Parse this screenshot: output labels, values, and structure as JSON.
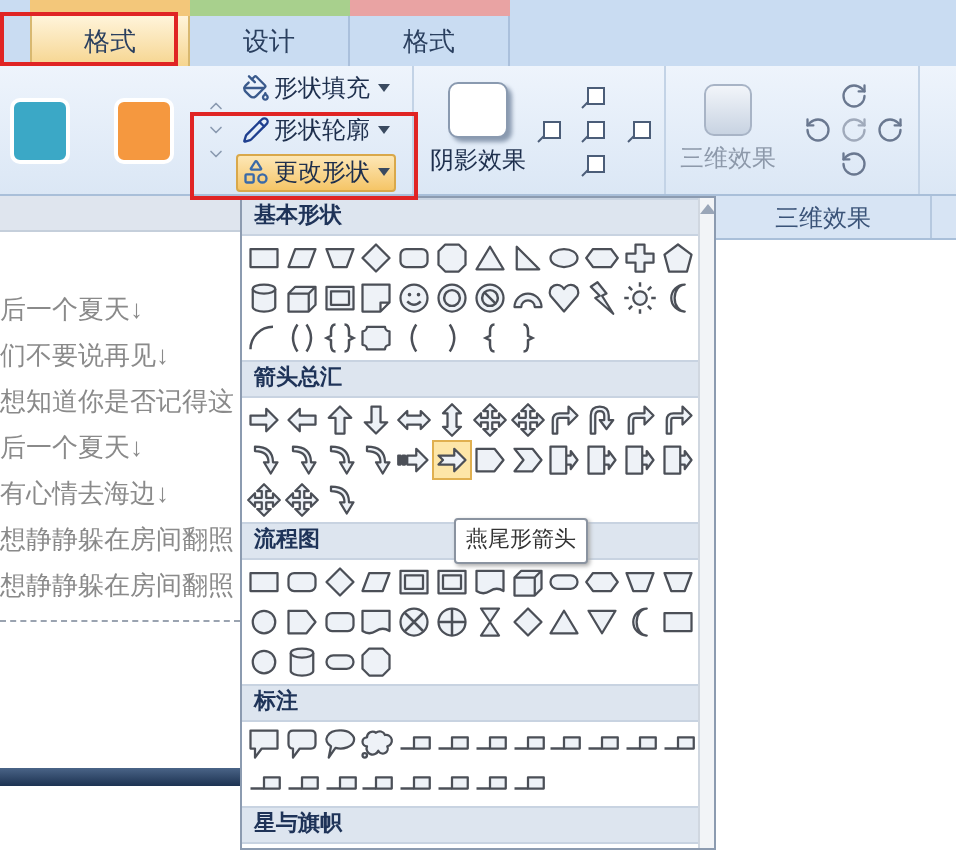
{
  "tabs": [
    {
      "label": "格式",
      "selected": true,
      "color": "#f3c77a"
    },
    {
      "label": "设计",
      "selected": false,
      "color": "#a8d08d"
    },
    {
      "label": "格式",
      "selected": false,
      "color": "#e9a3a3"
    }
  ],
  "ribbon": {
    "style_swatches": [
      {
        "color": "#3ba8c6"
      },
      {
        "color": "#f5983f"
      }
    ],
    "commands": [
      {
        "kind": "fill",
        "label": "形状填充",
        "selected": false
      },
      {
        "kind": "outline",
        "label": "形状轮廓",
        "selected": false
      },
      {
        "kind": "change",
        "label": "更改形状",
        "selected": true
      }
    ],
    "shadow_button": {
      "label": "阴影效果"
    },
    "three_d_button": {
      "label": "三维效果",
      "disabled": true
    },
    "group_label": "三维效果"
  },
  "document": {
    "lines": [
      "后一个夏天↓",
      "们不要说再见↓",
      "想知道你是否记得这",
      "后一个夏天↓",
      "有心情去海边↓",
      "想静静躲在房间翻照",
      "想静静躲在房间翻照"
    ]
  },
  "shape_menu": {
    "tooltip": "燕尾形箭头",
    "sections": [
      {
        "title": "基本形状",
        "rows": [
          [
            {
              "kind": "rect",
              "selected": false
            },
            {
              "kind": "parallelogram",
              "selected": false
            },
            {
              "kind": "trapezoid",
              "selected": false
            },
            {
              "kind": "diamond",
              "selected": false
            },
            {
              "kind": "roundrect",
              "selected": false
            },
            {
              "kind": "octagon",
              "selected": false
            },
            {
              "kind": "triangle",
              "selected": false
            },
            {
              "kind": "rtriangle",
              "selected": false
            },
            {
              "kind": "ellipse",
              "selected": false
            },
            {
              "kind": "hexagon",
              "selected": false
            },
            {
              "kind": "cross",
              "selected": false
            },
            {
              "kind": "pentagon",
              "selected": false
            }
          ],
          [
            {
              "kind": "cylinder",
              "selected": false
            },
            {
              "kind": "cube",
              "selected": false
            },
            {
              "kind": "frame",
              "selected": false
            },
            {
              "kind": "folded",
              "selected": false
            },
            {
              "kind": "smiley",
              "selected": false
            },
            {
              "kind": "donut",
              "selected": false
            },
            {
              "kind": "nosymbol",
              "selected": false
            },
            {
              "kind": "arch",
              "selected": false
            },
            {
              "kind": "heart",
              "selected": false
            },
            {
              "kind": "lightning",
              "selected": false
            },
            {
              "kind": "sun",
              "selected": false
            },
            {
              "kind": "moon",
              "selected": false
            }
          ],
          [
            {
              "kind": "arc",
              "selected": false
            },
            {
              "kind": "bracket",
              "selected": false
            },
            {
              "kind": "brace",
              "selected": false
            },
            {
              "kind": "plaque",
              "selected": false
            },
            {
              "kind": "bracket-l",
              "selected": false
            },
            {
              "kind": "bracket-r",
              "selected": false
            },
            {
              "kind": "brace-l",
              "selected": false
            },
            {
              "kind": "brace-r",
              "selected": false
            }
          ]
        ]
      },
      {
        "title": "箭头总汇",
        "rows": [
          [
            {
              "kind": "arrow-r",
              "selected": false
            },
            {
              "kind": "arrow-l",
              "selected": false
            },
            {
              "kind": "arrow-u",
              "selected": false
            },
            {
              "kind": "arrow-d",
              "selected": false
            },
            {
              "kind": "arrow-lr",
              "selected": false
            },
            {
              "kind": "arrow-ud",
              "selected": false
            },
            {
              "kind": "arrow-quad",
              "selected": false
            },
            {
              "kind": "arrow-quad",
              "selected": false
            },
            {
              "kind": "bent",
              "selected": false
            },
            {
              "kind": "uturn",
              "selected": false
            },
            {
              "kind": "bent",
              "selected": false
            },
            {
              "kind": "bent",
              "selected": false
            }
          ],
          [
            {
              "kind": "curved",
              "selected": false
            },
            {
              "kind": "curved",
              "selected": false
            },
            {
              "kind": "curved",
              "selected": false
            },
            {
              "kind": "curved",
              "selected": false
            },
            {
              "kind": "striped",
              "selected": false
            },
            {
              "kind": "notched",
              "selected": true
            },
            {
              "kind": "homeplate",
              "selected": false
            },
            {
              "kind": "chevron",
              "selected": false
            },
            {
              "kind": "callout-arrow",
              "selected": false
            },
            {
              "kind": "callout-arrow",
              "selected": false
            },
            {
              "kind": "callout-arrow",
              "selected": false
            },
            {
              "kind": "callout-arrow",
              "selected": false
            }
          ],
          [
            {
              "kind": "arrow-quad",
              "selected": false
            },
            {
              "kind": "arrow-quad",
              "selected": false
            },
            {
              "kind": "curved",
              "selected": false
            }
          ]
        ]
      },
      {
        "title": "流程图",
        "rows": [
          [
            {
              "kind": "rect",
              "selected": false
            },
            {
              "kind": "roundrect",
              "selected": false
            },
            {
              "kind": "diamond",
              "selected": false
            },
            {
              "kind": "parallelogram",
              "selected": false
            },
            {
              "kind": "frame",
              "selected": false
            },
            {
              "kind": "frame",
              "selected": false
            },
            {
              "kind": "doc",
              "selected": false
            },
            {
              "kind": "cube",
              "selected": false
            },
            {
              "kind": "pill",
              "selected": false
            },
            {
              "kind": "hexagon",
              "selected": false
            },
            {
              "kind": "trapezoid",
              "selected": false
            },
            {
              "kind": "trapezoid",
              "selected": false
            }
          ],
          [
            {
              "kind": "circle",
              "selected": false
            },
            {
              "kind": "homeplate",
              "selected": false
            },
            {
              "kind": "roundrect",
              "selected": false
            },
            {
              "kind": "doc",
              "selected": false
            },
            {
              "kind": "circle-x",
              "selected": false
            },
            {
              "kind": "circle-plus",
              "selected": false
            },
            {
              "kind": "hourglass",
              "selected": false
            },
            {
              "kind": "diamond",
              "selected": false
            },
            {
              "kind": "triangle",
              "selected": false
            },
            {
              "kind": "triangle-down",
              "selected": false
            },
            {
              "kind": "moon",
              "selected": false
            },
            {
              "kind": "rect",
              "selected": false
            }
          ],
          [
            {
              "kind": "circle",
              "selected": false
            },
            {
              "kind": "cylinder",
              "selected": false
            },
            {
              "kind": "pill",
              "selected": false
            },
            {
              "kind": "octagon",
              "selected": false
            }
          ]
        ]
      },
      {
        "title": "标注",
        "rows": [
          [
            {
              "kind": "callout-rect",
              "selected": false
            },
            {
              "kind": "callout-round",
              "selected": false
            },
            {
              "kind": "callout-oval",
              "selected": false
            },
            {
              "kind": "callout-cloud",
              "selected": false
            },
            {
              "kind": "line-callout",
              "selected": false
            },
            {
              "kind": "line-callout",
              "selected": false
            },
            {
              "kind": "line-callout",
              "selected": false
            },
            {
              "kind": "line-callout",
              "selected": false
            },
            {
              "kind": "line-callout",
              "selected": false
            },
            {
              "kind": "line-callout",
              "selected": false
            },
            {
              "kind": "line-callout",
              "selected": false
            },
            {
              "kind": "line-callout",
              "selected": false
            }
          ],
          [
            {
              "kind": "line-callout",
              "selected": false
            },
            {
              "kind": "line-callout",
              "selected": false
            },
            {
              "kind": "line-callout",
              "selected": false
            },
            {
              "kind": "line-callout",
              "selected": false
            },
            {
              "kind": "line-callout",
              "selected": false
            },
            {
              "kind": "line-callout",
              "selected": false
            },
            {
              "kind": "line-callout",
              "selected": false
            },
            {
              "kind": "line-callout",
              "selected": false
            }
          ]
        ]
      },
      {
        "title": "星与旗帜"
      }
    ]
  }
}
